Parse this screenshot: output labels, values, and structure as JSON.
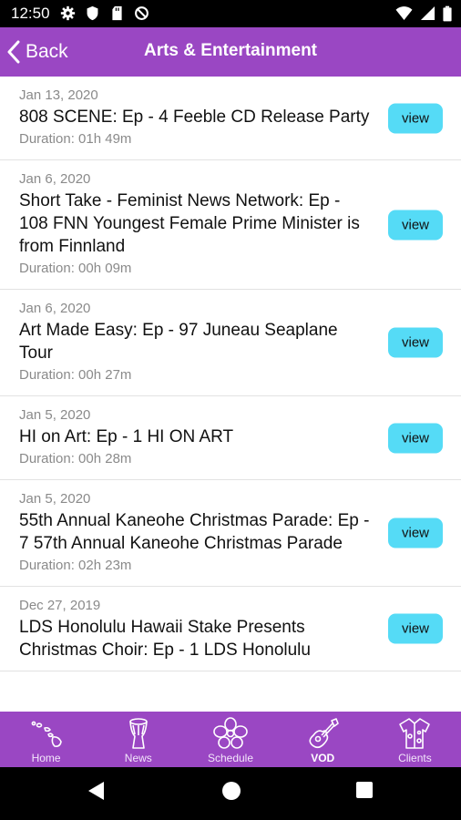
{
  "status_bar": {
    "time": "12:50"
  },
  "header": {
    "back_label": "Back",
    "title": "Arts & Entertainment"
  },
  "episodes": [
    {
      "date": "Jan 13, 2020",
      "title": "808 SCENE: Ep - 4 Feeble CD Release Party",
      "duration": "Duration: 01h 49m",
      "button": "view"
    },
    {
      "date": "Jan 6, 2020",
      "title": "Short Take - Feminist News Network: Ep - 108 FNN Youngest Female Prime Minister is from Finnland",
      "duration": "Duration: 00h 09m",
      "button": "view"
    },
    {
      "date": "Jan 6, 2020",
      "title": "Art Made Easy: Ep - 97 Juneau Seaplane Tour",
      "duration": "Duration: 00h 27m",
      "button": "view"
    },
    {
      "date": "Jan 5, 2020",
      "title": "HI on Art: Ep - 1 HI ON ART",
      "duration": "Duration: 00h 28m",
      "button": "view"
    },
    {
      "date": "Jan 5, 2020",
      "title": "55th Annual Kaneohe Christmas Parade: Ep - 7 57th Annual Kaneohe Christmas Parade",
      "duration": "Duration: 02h 23m",
      "button": "view"
    },
    {
      "date": "Dec 27, 2019",
      "title": "LDS Honolulu Hawaii Stake Presents Christmas Choir: Ep - 1 LDS Honolulu",
      "duration": "",
      "button": "view"
    }
  ],
  "tabs": [
    {
      "label": "Home",
      "icon": "islands-icon"
    },
    {
      "label": "News",
      "icon": "drum-icon"
    },
    {
      "label": "Schedule",
      "icon": "hibiscus-icon"
    },
    {
      "label": "VOD",
      "icon": "ukulele-icon",
      "active": true
    },
    {
      "label": "Clients",
      "icon": "aloha-shirt-icon"
    }
  ],
  "colors": {
    "header": "#9a47c3",
    "view_button": "#55dbf6"
  }
}
